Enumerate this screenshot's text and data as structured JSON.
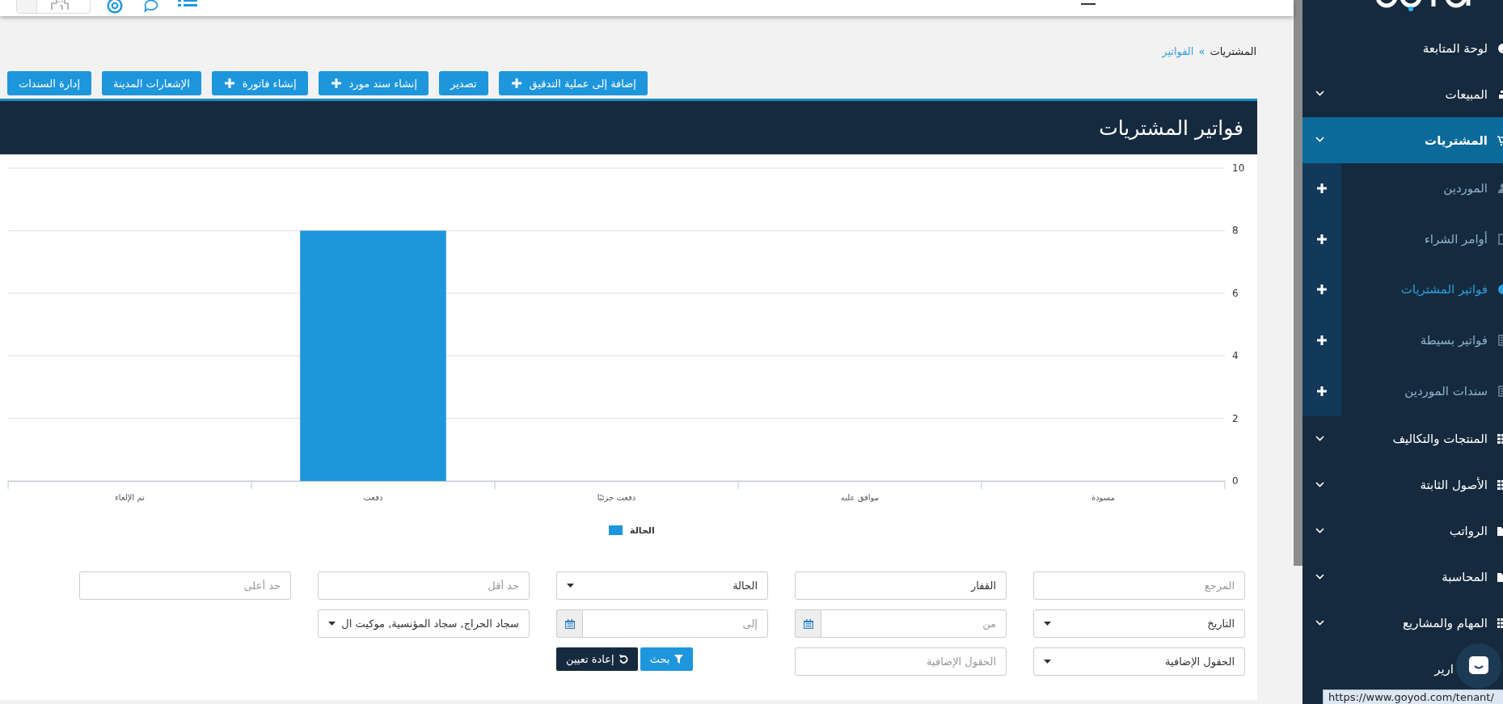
{
  "breadcrumb": {
    "parent": "المشتريات",
    "separator": "»",
    "current": "الفواتير"
  },
  "actions": [
    {
      "label": "إضافة إلى عملية التدقيق",
      "plus": true
    },
    {
      "label": "تصدير",
      "plus": false
    },
    {
      "label": "إنشاء سند مورد",
      "plus": true
    },
    {
      "label": "إنشاء فاتورة",
      "plus": true
    },
    {
      "label": "الإشعارات المدينة",
      "plus": false
    },
    {
      "label": "إدارة السندات",
      "plus": false
    }
  ],
  "panel": {
    "title": "فواتير المشتريات",
    "chart_data": {
      "type": "bar",
      "categories": [
        "تم الإلغاء",
        "دفعت",
        "دفعت جزئيًا",
        "موافق عليه",
        "مسودة"
      ],
      "series": [
        {
          "name": "الحالة",
          "color": "#1e96dc",
          "values": [
            0,
            8,
            0,
            0,
            0
          ]
        }
      ],
      "ylim": [
        0,
        10
      ],
      "yticks": [
        0,
        2,
        4,
        6,
        8,
        10
      ],
      "grid": true
    }
  },
  "filters": [
    {
      "kind": "input",
      "placeholder": "المرجع"
    },
    {
      "kind": "input",
      "value": "القفار"
    },
    {
      "kind": "select",
      "value": "الحالة"
    },
    {
      "kind": "input",
      "placeholder": "حد أقل"
    },
    {
      "kind": "input",
      "placeholder": "حد أعلى"
    },
    {
      "kind": "select",
      "value": "التاريخ"
    },
    {
      "kind": "date",
      "placeholder": "من"
    },
    {
      "kind": "date",
      "placeholder": "إلى"
    },
    {
      "kind": "select",
      "value": "سجاد الحراج, سجاد المؤنسية, موكيت ال"
    },
    {
      "kind": "empty"
    },
    {
      "kind": "select",
      "value": "الحقول الإضافية"
    },
    {
      "kind": "input",
      "placeholder": "الحقول الإضافية"
    },
    {
      "kind": "buttons"
    }
  ],
  "filter_buttons": [
    {
      "kind": "search",
      "label": "بحث"
    },
    {
      "kind": "reset",
      "label": "إعادة تعيين"
    }
  ],
  "sidebar": {
    "items": [
      {
        "label": "لوحة المتابعة",
        "selected": false,
        "has_submenu": false
      },
      {
        "label": "المبيعات",
        "selected": false,
        "has_submenu": true
      },
      {
        "label": "المشتريات",
        "selected": true,
        "has_submenu": true,
        "children": [
          {
            "label": "الموردين",
            "selected": false
          },
          {
            "label": "أوامر الشراء",
            "selected": false
          },
          {
            "label": "فواتير المشتريات",
            "selected": true
          },
          {
            "label": "فواتير بسيطة",
            "selected": false
          },
          {
            "label": "سندات الموردين",
            "selected": false
          }
        ]
      },
      {
        "label": "المنتجات والتكاليف",
        "selected": false,
        "has_submenu": true
      },
      {
        "label": "الأصول الثابتة",
        "selected": false,
        "has_submenu": true
      },
      {
        "label": "الرواتب",
        "selected": false,
        "has_submenu": true
      },
      {
        "label": "المحاسبة",
        "selected": false,
        "has_submenu": true
      },
      {
        "label": "المهام والمشاريع",
        "selected": false,
        "has_submenu": true
      },
      {
        "label": "ارير",
        "selected": false,
        "has_submenu": false,
        "covered": true
      }
    ]
  },
  "status_url": "https://www.goyod.com/tenant/"
}
